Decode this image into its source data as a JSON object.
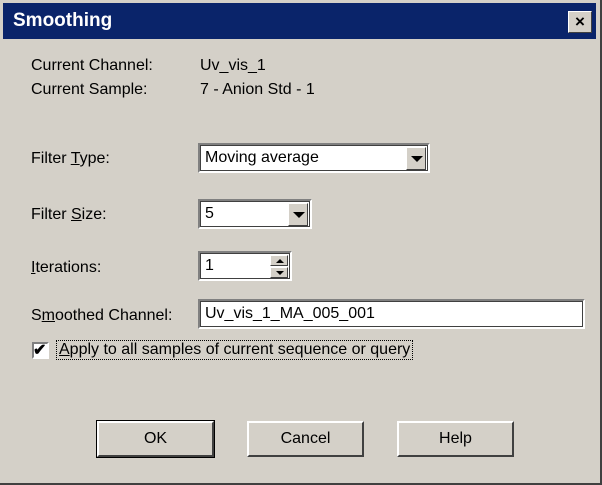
{
  "window": {
    "title": "Smoothing",
    "close_label": "×"
  },
  "info": {
    "current_channel_label": "Current Channel:",
    "current_channel_value": "Uv_vis_1",
    "current_sample_label": "Current Sample:",
    "current_sample_value": "7 - Anion Std - 1"
  },
  "filter_type": {
    "label_pre": "Filter ",
    "label_key": "T",
    "label_post": "ype:",
    "value": "Moving average"
  },
  "filter_size": {
    "label_pre": "Filter ",
    "label_key": "S",
    "label_post": "ize:",
    "value": "5"
  },
  "iterations": {
    "label_key": "I",
    "label_post": "terations:",
    "value": "1"
  },
  "smoothed_channel": {
    "label_pre": "S",
    "label_key": "m",
    "label_post": "oothed Channel:",
    "value": "Uv_vis_1_MA_005_001"
  },
  "apply_all": {
    "checked": true,
    "mark": "✔",
    "label_key": "A",
    "label_post": "pply to all samples of current sequence or query"
  },
  "buttons": {
    "ok": "OK",
    "cancel": "Cancel",
    "help": "Help"
  }
}
